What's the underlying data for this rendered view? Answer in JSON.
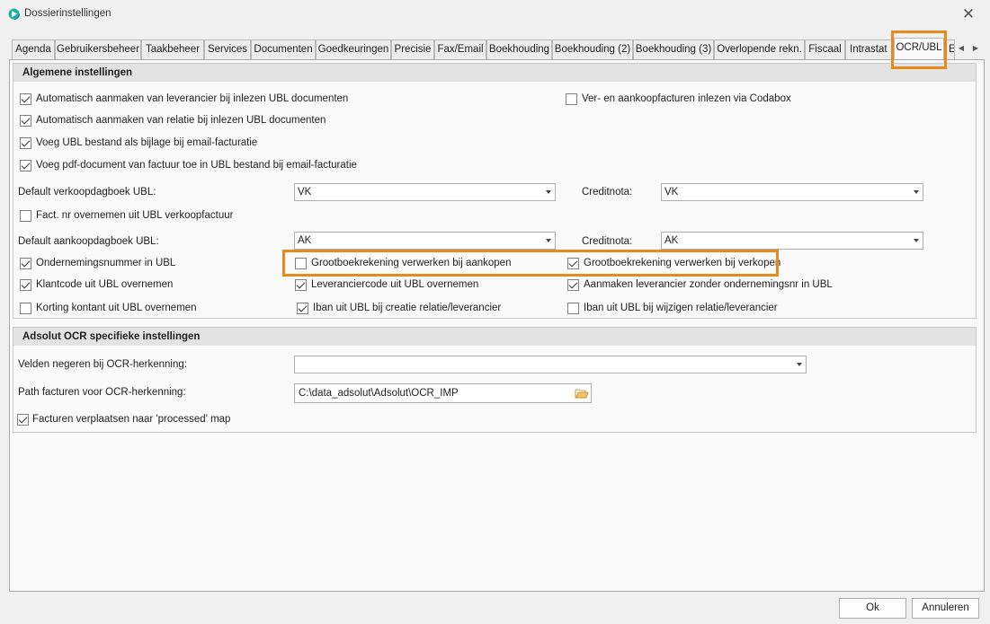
{
  "window": {
    "title": "Dossierinstellingen"
  },
  "tabs": [
    "Agenda",
    "Gebruikersbeheer",
    "Taakbeheer",
    "Services",
    "Documenten",
    "Goedkeuringen",
    "Precisie",
    "Fax/Email",
    "Boekhouding",
    "Boekhouding (2)",
    "Boekhouding (3)",
    "Overlopende rekn.",
    "Fiscaal",
    "Intrastat",
    "OCR/UBL",
    "E"
  ],
  "active_tab": "OCR/UBL",
  "general": {
    "header": "Algemene instellingen",
    "cb_auto_supplier": {
      "label": "Automatisch aanmaken van leverancier bij inlezen UBL documenten",
      "checked": true
    },
    "cb_auto_relation": {
      "label": "Automatisch aanmaken van relatie bij inlezen UBL documenten",
      "checked": true
    },
    "cb_attach_ubl": {
      "label": "Voeg UBL bestand als bijlage bij email-facturatie",
      "checked": true
    },
    "cb_add_pdf": {
      "label": "Voeg pdf-document van factuur toe in UBL bestand bij email-facturatie",
      "checked": true
    },
    "cb_codabox": {
      "label": "Ver- en aankoopfacturen inlezen via Codabox",
      "checked": false
    },
    "sales_journal_label": "Default verkoopdagboek UBL:",
    "sales_journal_value": "VK",
    "sales_credit_label": "Creditnota:",
    "sales_credit_value": "VK",
    "cb_fact_nr": {
      "label": "Fact. nr overnemen uit UBL verkoopfactuur",
      "checked": false
    },
    "purchase_journal_label": "Default aankoopdagboek UBL:",
    "purchase_journal_value": "AK",
    "purchase_credit_label": "Creditnota:",
    "purchase_credit_value": "AK",
    "cb_company_nr": {
      "label": "Ondernemingsnummer in UBL",
      "checked": true
    },
    "cb_gl_purchases": {
      "label": "Grootboekrekening verwerken bij aankopen",
      "checked": false
    },
    "cb_gl_sales": {
      "label": "Grootboekrekening verwerken bij verkopen",
      "checked": true
    },
    "cb_client_code": {
      "label": "Klantcode uit UBL overnemen",
      "checked": true
    },
    "cb_supplier_code": {
      "label": "Leveranciercode uit UBL overnemen",
      "checked": true
    },
    "cb_create_supplier_no_nr": {
      "label": "Aanmaken leverancier zonder ondernemingsnr in UBL",
      "checked": true
    },
    "cb_discount": {
      "label": "Korting kontant uit UBL overnemen",
      "checked": false
    },
    "cb_iban_create": {
      "label": "Iban uit UBL bij creatie relatie/leverancier",
      "checked": true
    },
    "cb_iban_modify": {
      "label": "Iban uit UBL bij wijzigen relatie/leverancier",
      "checked": false
    }
  },
  "ocr": {
    "header": "Adsolut OCR specifieke instellingen",
    "ignore_fields_label": "Velden negeren bij OCR-herkenning:",
    "ignore_fields_value": "",
    "path_label": "Path facturen voor OCR-herkenning:",
    "path_value": "C:\\data_adsolut\\Adsolut\\OCR_IMP",
    "cb_move_processed": {
      "label": "Facturen verplaatsen naar 'processed' map",
      "checked": true
    }
  },
  "buttons": {
    "ok": "Ok",
    "cancel": "Annuleren"
  },
  "colors": {
    "highlight": "#e8891c",
    "panel_bg": "#fafafa",
    "header_bg": "#e3e3e3"
  }
}
